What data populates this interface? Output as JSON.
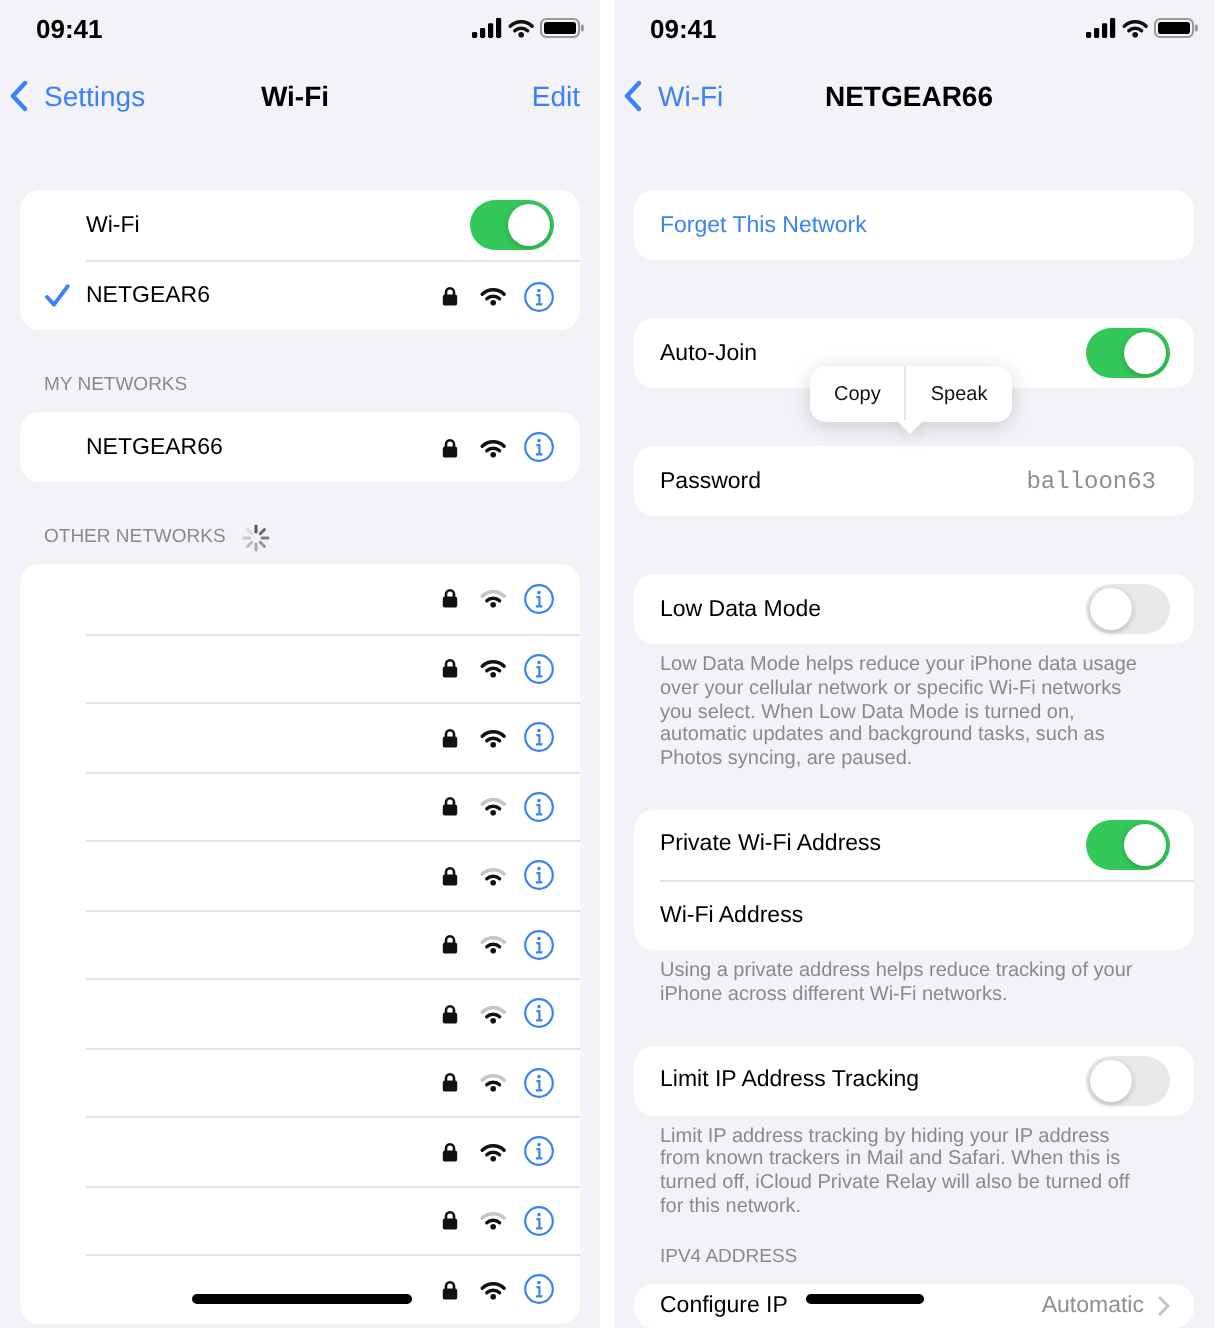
{
  "wifi_screen": {
    "status_bar": {
      "time": "09:41"
    },
    "nav_bar": {
      "back": "Settings",
      "title": "Wi-Fi",
      "action": "Edit"
    },
    "wifi_switch": {
      "label": "Wi-Fi",
      "on": true
    },
    "current_network": {
      "name": "NETGEAR6",
      "selected": true,
      "secured": true,
      "full_signal": true
    },
    "my_networks": {
      "header": "MY NETWORKS",
      "items": [
        {
          "name": "NETGEAR66",
          "selected": false,
          "secured": true,
          "full_signal": true
        }
      ]
    },
    "other_networks": {
      "header": "OTHER NETWORKS",
      "scanning": true,
      "items": [
        {
          "selected": false,
          "secured": true,
          "full_signal": false
        },
        {
          "selected": false,
          "secured": true,
          "full_signal": true
        },
        {
          "selected": false,
          "secured": true,
          "full_signal": true
        },
        {
          "selected": false,
          "secured": true,
          "full_signal": false
        },
        {
          "selected": false,
          "secured": true,
          "full_signal": false
        },
        {
          "selected": false,
          "secured": true,
          "full_signal": false
        },
        {
          "selected": false,
          "secured": true,
          "full_signal": false
        },
        {
          "selected": false,
          "secured": true,
          "full_signal": false
        },
        {
          "selected": false,
          "secured": true,
          "full_signal": true
        },
        {
          "selected": false,
          "secured": true,
          "full_signal": false
        },
        {
          "selected": false,
          "secured": true,
          "full_signal": true
        }
      ]
    }
  },
  "network_screen": {
    "status_bar": {
      "time": "09:41"
    },
    "nav_bar": {
      "back": "Wi-Fi",
      "title": "NETGEAR66"
    },
    "sections": [
      {
        "rows": [
          {
            "kind": "action",
            "label": "Forget This Network"
          }
        ]
      },
      {
        "rows": [
          {
            "kind": "toggle",
            "label": "Auto-Join",
            "on": true
          }
        ]
      },
      {
        "rows": [
          {
            "kind": "value",
            "label": "Password",
            "value": "balloon63",
            "menu": [
              {
                "label": "Copy"
              },
              {
                "label": "Speak"
              }
            ]
          }
        ]
      },
      {
        "rows": [
          {
            "kind": "toggle",
            "label": "Low Data Mode",
            "on": false
          }
        ],
        "footer": "Low Data Mode helps reduce your iPhone data usage over your cellular network or specific Wi-Fi networks you select. When Low Data Mode is turned on, automatic updates and background tasks, such as Photos syncing, are paused."
      },
      {
        "rows": [
          {
            "kind": "toggle",
            "label": "Private Wi-Fi Address",
            "on": true
          },
          {
            "kind": "plain",
            "label": "Wi-Fi Address"
          }
        ],
        "footer": "Using a private address helps reduce tracking of your iPhone across different Wi-Fi networks."
      },
      {
        "rows": [
          {
            "kind": "toggle",
            "label": "Limit IP Address Tracking",
            "on": false
          }
        ],
        "footer": "Limit IP address tracking by hiding your IP address from known trackers in Mail and Safari. When this is turned off, iCloud Private Relay will also be turned off for this network."
      },
      {
        "header": "IPV4 ADDRESS",
        "rows": [
          {
            "kind": "link",
            "label": "Configure IP",
            "value": "Automatic"
          }
        ]
      }
    ]
  }
}
